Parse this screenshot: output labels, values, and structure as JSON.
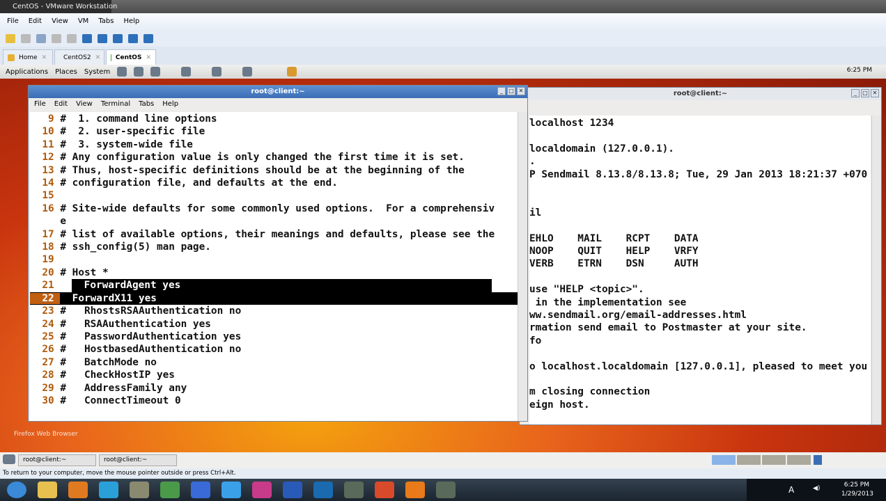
{
  "vmware": {
    "title": "CentOS - VMware Workstation",
    "menu": [
      "File",
      "Edit",
      "View",
      "VM",
      "Tabs",
      "Help"
    ],
    "tabs": [
      {
        "label": "Home"
      },
      {
        "label": "CentOS2"
      },
      {
        "label": "CentOS",
        "active": true
      }
    ],
    "status": "To return to your computer, move the mouse pointer outside or press Ctrl+Alt."
  },
  "gnome": {
    "menu": [
      "Applications",
      "Places",
      "System"
    ],
    "clock": "6:25 PM",
    "desktop_icon": "Firefox Web Browser",
    "tasks": [
      "root@client:~",
      "root@client:~"
    ]
  },
  "term1": {
    "title": "root@client:~",
    "menu": [
      "File",
      "Edit",
      "View",
      "Terminal",
      "Tabs",
      "Help"
    ],
    "lines": [
      {
        "n": "9",
        "t": "#  1. command line options"
      },
      {
        "n": "10",
        "t": "#  2. user-specific file"
      },
      {
        "n": "11",
        "t": "#  3. system-wide file"
      },
      {
        "n": "12",
        "t": "# Any configuration value is only changed the first time it is set."
      },
      {
        "n": "13",
        "t": "# Thus, host-specific definitions should be at the beginning of the"
      },
      {
        "n": "14",
        "t": "# configuration file, and defaults at the end."
      },
      {
        "n": "15",
        "t": ""
      },
      {
        "n": "16",
        "t": "# Site-wide defaults for some commonly used options.  For a comprehensiv"
      },
      {
        "n": "",
        "t": "e"
      },
      {
        "n": "17",
        "t": "# list of available options, their meanings and defaults, please see the"
      },
      {
        "n": "18",
        "t": "# ssh_config(5) man page."
      },
      {
        "n": "19",
        "t": ""
      },
      {
        "n": "20",
        "t": "# Host *"
      },
      {
        "n": "21",
        "t": "  ForwardAgent yes",
        "hl": "sel"
      },
      {
        "n": "22",
        "t": "  ForwardX11 yes",
        "hl": "cur"
      },
      {
        "n": "23",
        "t": "#   RhostsRSAAuthentication no"
      },
      {
        "n": "24",
        "t": "#   RSAAuthentication yes"
      },
      {
        "n": "25",
        "t": "#   PasswordAuthentication yes"
      },
      {
        "n": "26",
        "t": "#   HostbasedAuthentication no"
      },
      {
        "n": "27",
        "t": "#   BatchMode no"
      },
      {
        "n": "28",
        "t": "#   CheckHostIP yes"
      },
      {
        "n": "29",
        "t": "#   AddressFamily any"
      },
      {
        "n": "30",
        "t": "#   ConnectTimeout 0"
      }
    ]
  },
  "term2": {
    "title": "root@client:~",
    "lines": [
      "localhost 1234",
      "",
      "localdomain (127.0.0.1).",
      ".",
      "P Sendmail 8.13.8/8.13.8; Tue, 29 Jan 2013 18:21:37 +070",
      "",
      "",
      "il",
      "",
      "EHLO    MAIL    RCPT    DATA",
      "NOOP    QUIT    HELP    VRFY",
      "VERB    ETRN    DSN     AUTH",
      "",
      "use \"HELP <topic>\".",
      " in the implementation see",
      "ww.sendmail.org/email-addresses.html",
      "rmation send email to Postmaster at your site.",
      "fo",
      "",
      "o localhost.localdomain [127.0.0.1], pleased to meet you",
      "",
      "m closing connection",
      "eign host."
    ]
  },
  "windows": {
    "time": "6:25 PM",
    "date": "1/29/2013",
    "lang": "A"
  }
}
